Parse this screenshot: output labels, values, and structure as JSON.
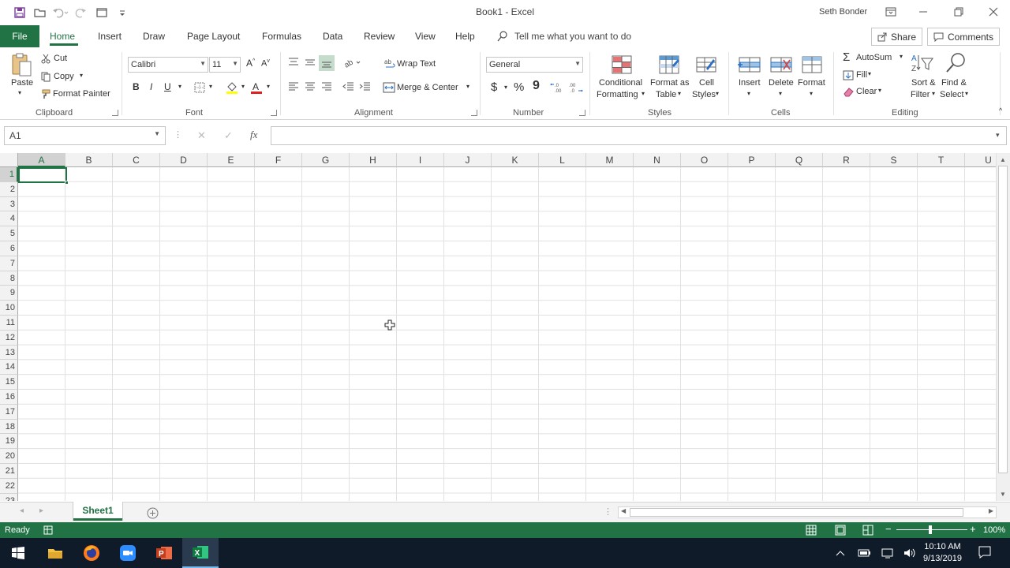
{
  "window": {
    "doc_title": "Book1  -  Excel",
    "user": "Seth Bonder"
  },
  "tabs": {
    "file": "File",
    "items": [
      "Home",
      "Insert",
      "Draw",
      "Page Layout",
      "Formulas",
      "Data",
      "Review",
      "View",
      "Help"
    ],
    "active": "Home",
    "tell_me": "Tell me what you want to do",
    "share": "Share",
    "comments": "Comments"
  },
  "ribbon": {
    "clipboard": {
      "label": "Clipboard",
      "paste": "Paste",
      "cut": "Cut",
      "copy": "Copy",
      "format_painter": "Format Painter"
    },
    "font": {
      "label": "Font",
      "font_name": "Calibri",
      "font_size": "11",
      "bold": "B",
      "italic": "I",
      "underline": "U"
    },
    "alignment": {
      "label": "Alignment",
      "wrap_text": "Wrap Text",
      "merge_center": "Merge & Center"
    },
    "number": {
      "label": "Number",
      "format": "General",
      "currency": "$",
      "percent": "%",
      "comma": "9"
    },
    "styles": {
      "label": "Styles",
      "conditional_1": "Conditional",
      "conditional_2": "Formatting",
      "format_table_1": "Format as",
      "format_table_2": "Table",
      "cell_styles_1": "Cell",
      "cell_styles_2": "Styles"
    },
    "cells": {
      "label": "Cells",
      "insert": "Insert",
      "delete": "Delete",
      "format": "Format"
    },
    "editing": {
      "label": "Editing",
      "autosum": "AutoSum",
      "fill": "Fill",
      "clear": "Clear",
      "sort_1": "Sort &",
      "sort_2": "Filter",
      "find_1": "Find &",
      "find_2": "Select"
    }
  },
  "formula_bar": {
    "name_box": "A1",
    "fx": "fx",
    "value": ""
  },
  "grid": {
    "columns": [
      "A",
      "B",
      "C",
      "D",
      "E",
      "F",
      "G",
      "H",
      "I",
      "J",
      "K",
      "L",
      "M",
      "N",
      "O",
      "P",
      "Q",
      "R",
      "S",
      "T",
      "U"
    ],
    "rows": [
      "1",
      "2",
      "3",
      "4",
      "5",
      "6",
      "7",
      "8",
      "9",
      "10",
      "11",
      "12",
      "13",
      "14",
      "15",
      "16",
      "17",
      "18",
      "19",
      "20",
      "21",
      "22",
      "23"
    ],
    "selected_cell": "A1"
  },
  "sheets": {
    "tabs": [
      "Sheet1"
    ],
    "active": "Sheet1"
  },
  "status": {
    "ready": "Ready",
    "zoom": "100%"
  },
  "taskbar": {
    "time": "10:10 AM",
    "date": "9/13/2019"
  },
  "colors": {
    "accent": "#217346",
    "taskbar": "#101b2a"
  }
}
